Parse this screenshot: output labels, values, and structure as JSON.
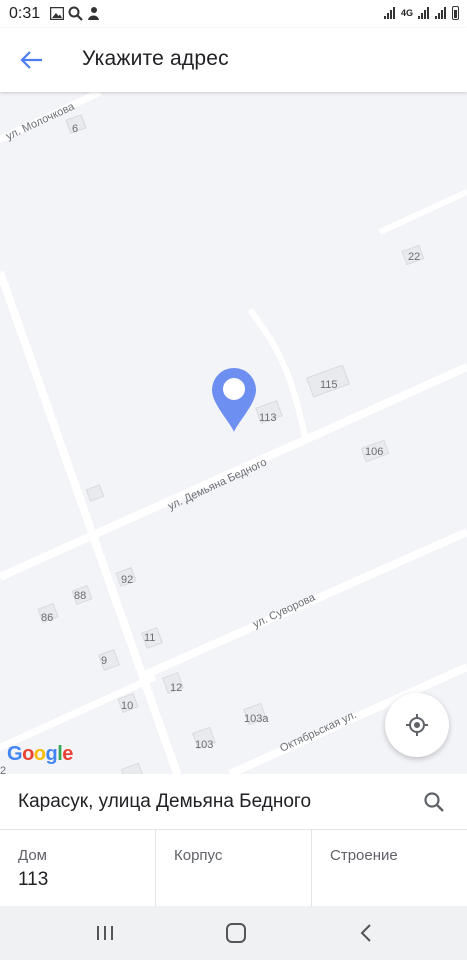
{
  "status_bar": {
    "time": "0:31",
    "network": "4G",
    "icons": [
      "image-icon",
      "search-icon",
      "app-icon",
      "signal-icon",
      "signal-4g-icon",
      "signal-icon",
      "battery-icon"
    ]
  },
  "app_bar": {
    "title": "Укажите адрес",
    "back_icon": "arrow-left-icon"
  },
  "map": {
    "streets": {
      "molochkova": "ул. Молочкова",
      "demyana": "ул. Демьяна Бедного",
      "suvorova": "ул. Суворова",
      "oktyabrskaya": "Октябрьская ул."
    },
    "houses": {
      "h6": "6",
      "h22": "22",
      "h115": "115",
      "h113": "113",
      "h106": "106",
      "h92": "92",
      "h88": "88",
      "h86": "86",
      "h11": "11",
      "h9": "9",
      "h12": "12",
      "h10": "10",
      "h103a": "103а",
      "h103": "103",
      "h2": "2"
    },
    "pin_icon": "map-pin-icon",
    "pin_color": "#6e8ff2",
    "locate_icon": "my-location-icon",
    "attribution": {
      "letters": [
        "G",
        "o",
        "o",
        "g",
        "l",
        "e"
      ],
      "colors": [
        "#4285f4",
        "#ea4335",
        "#fbbc05",
        "#4285f4",
        "#34a853",
        "#ea4335"
      ]
    }
  },
  "address": {
    "text": "Карасук, улица Демьяна Бедного",
    "search_icon": "search-icon"
  },
  "fields": [
    {
      "label": "Дом",
      "value": "113"
    },
    {
      "label": "Корпус",
      "value": ""
    },
    {
      "label": "Строение",
      "value": ""
    }
  ],
  "nav_bar": {
    "icons": [
      "recent-apps-icon",
      "home-icon",
      "back-icon"
    ]
  },
  "colors": {
    "accent": "#4a7ef0",
    "map_bg": "#f3f4f8",
    "road": "#ffffff"
  }
}
